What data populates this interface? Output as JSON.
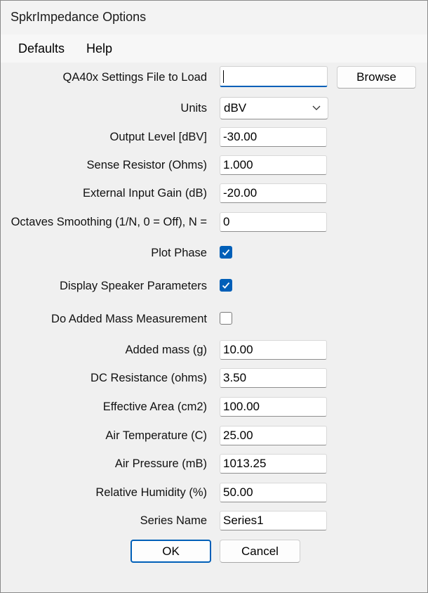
{
  "window": {
    "title": "SpkrImpedance Options"
  },
  "menu": {
    "items": [
      "Defaults",
      "Help"
    ]
  },
  "settings_file": {
    "label": "QA40x Settings File to Load",
    "value": "",
    "browse_label": "Browse"
  },
  "units": {
    "label": "Units",
    "value": "dBV"
  },
  "fields": {
    "output_level": {
      "label": "Output Level [dBV]",
      "value": "-30.00"
    },
    "sense_resistor": {
      "label": "Sense Resistor (Ohms)",
      "value": "1.000"
    },
    "external_gain": {
      "label": "External Input Gain (dB)",
      "value": "-20.00"
    },
    "smoothing": {
      "label": "Octaves Smoothing (1/N, 0 = Off), N =",
      "value": "0"
    },
    "added_mass": {
      "label": "Added mass (g)",
      "value": "10.00"
    },
    "dc_resistance": {
      "label": "DC Resistance (ohms)",
      "value": "3.50"
    },
    "effective_area": {
      "label": "Effective Area (cm2)",
      "value": "100.00"
    },
    "air_temp": {
      "label": "Air Temperature (C)",
      "value": "25.00"
    },
    "air_pressure": {
      "label": "Air Pressure (mB)",
      "value": "1013.25"
    },
    "humidity": {
      "label": "Relative Humidity (%)",
      "value": "50.00"
    },
    "series_name": {
      "label": "Series Name",
      "value": "Series1"
    }
  },
  "checks": {
    "plot_phase": {
      "label": "Plot Phase",
      "checked": true
    },
    "display_params": {
      "label": "Display Speaker Parameters",
      "checked": true
    },
    "added_mass_meas": {
      "label": "Do Added Mass Measurement",
      "checked": false
    }
  },
  "buttons": {
    "ok": "OK",
    "cancel": "Cancel"
  },
  "colors": {
    "accent": "#005fb8",
    "background": "#f0f0f0"
  }
}
